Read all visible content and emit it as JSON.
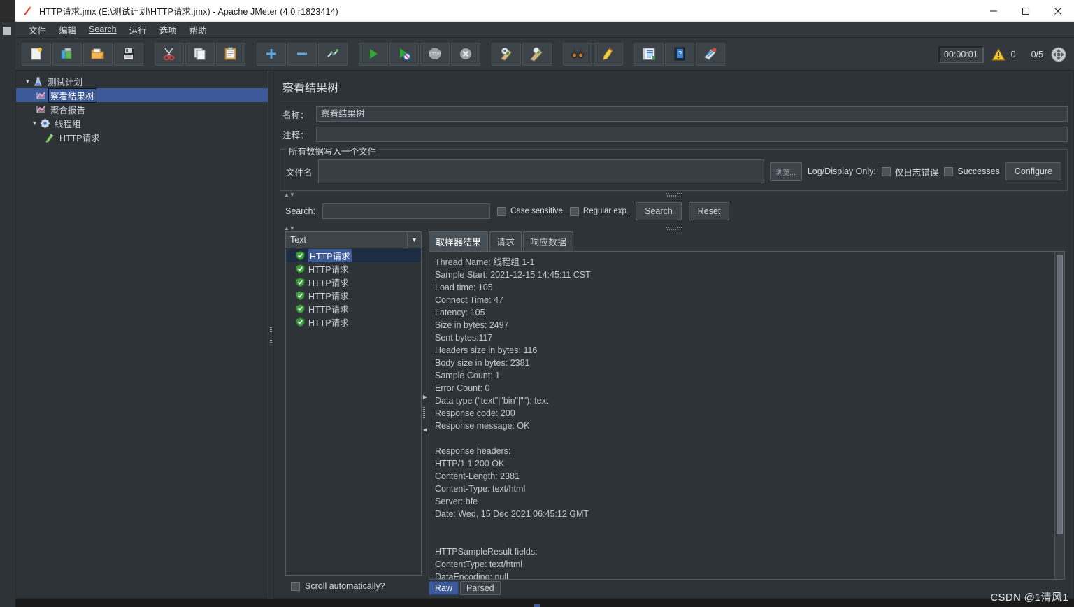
{
  "window": {
    "title": "HTTP请求.jmx (E:\\测试计划\\HTTP请求.jmx) - Apache JMeter (4.0 r1823414)",
    "app_icon": "jmeter-feather-icon",
    "minimize_label": "—",
    "maximize_label": "☐",
    "close_label": "✕"
  },
  "menubar": {
    "items": [
      {
        "label": "文件",
        "name": "menu-file"
      },
      {
        "label": "编辑",
        "name": "menu-edit"
      },
      {
        "label": "Search",
        "name": "menu-search",
        "mnemonic": "S"
      },
      {
        "label": "运行",
        "name": "menu-run"
      },
      {
        "label": "选项",
        "name": "menu-options"
      },
      {
        "label": "帮助",
        "name": "menu-help"
      }
    ]
  },
  "toolbar": {
    "buttons": [
      {
        "name": "new-icon",
        "title": "新建"
      },
      {
        "name": "templates-icon",
        "title": "模板"
      },
      {
        "name": "open-icon",
        "title": "打开"
      },
      {
        "name": "save-icon",
        "title": "保存"
      },
      {
        "name": "cut-icon",
        "title": "剪切"
      },
      {
        "name": "copy-icon",
        "title": "复制"
      },
      {
        "name": "paste-icon",
        "title": "粘贴"
      },
      {
        "name": "expand-all-icon",
        "title": "展开"
      },
      {
        "name": "collapse-all-icon",
        "title": "折叠"
      },
      {
        "name": "toggle-icon",
        "title": "启用/禁用"
      },
      {
        "name": "start-icon",
        "title": "启动"
      },
      {
        "name": "start-no-timers-icon",
        "title": "无暂停启动"
      },
      {
        "name": "stop-icon",
        "title": "停止"
      },
      {
        "name": "shutdown-icon",
        "title": "关闭"
      },
      {
        "name": "clear-icon",
        "title": "清除"
      },
      {
        "name": "clear-all-icon",
        "title": "清除全部"
      },
      {
        "name": "search-binoculars-icon",
        "title": "查找"
      },
      {
        "name": "reset-search-icon",
        "title": "重置查找"
      },
      {
        "name": "function-helper-icon",
        "title": "函数助手"
      },
      {
        "name": "help-icon",
        "title": "帮助"
      },
      {
        "name": "undo-redo-icon",
        "title": "撤销"
      }
    ],
    "timer": "00:00:01",
    "warning_icon": "warning-triangle-icon",
    "warning_count": "0",
    "thread_count": "0/5",
    "gc_icon": "clear-gc-icon"
  },
  "tree": {
    "nodes": [
      {
        "label": "测试计划",
        "icon": "test-plan-icon",
        "depth": 0,
        "toggle": "▼",
        "selected": false,
        "name": "tree-node-test-plan"
      },
      {
        "label": "察看结果树",
        "icon": "view-results-tree-icon",
        "depth": 1,
        "toggle": "",
        "selected": true,
        "name": "tree-node-view-results-tree"
      },
      {
        "label": "聚合报告",
        "icon": "aggregate-report-icon",
        "depth": 1,
        "toggle": "",
        "selected": false,
        "name": "tree-node-aggregate-report"
      },
      {
        "label": "线程组",
        "icon": "thread-group-icon",
        "depth": 0,
        "toggle": "▼",
        "selected": false,
        "name": "tree-node-thread-group"
      },
      {
        "label": "HTTP请求",
        "icon": "http-request-icon",
        "depth": 1,
        "toggle": "",
        "selected": false,
        "name": "tree-node-http-request"
      }
    ]
  },
  "panel": {
    "title": "察看结果树",
    "name_label": "名称：",
    "name_value": "察看结果树",
    "comment_label": "注释：",
    "comment_value": "",
    "filegroup": {
      "legend": "所有数据写入一个文件",
      "filename_label": "文件名",
      "filename_value": "",
      "browse_label": "浏览...",
      "logdisplay_label": "Log/Display Only:",
      "errors_only_label": "仅日志错误",
      "errors_only_checked": false,
      "successes_label": "Successes",
      "successes_checked": false,
      "configure_label": "Configure"
    },
    "search": {
      "label": "Search:",
      "value": "",
      "case_sensitive_label": "Case sensitive",
      "case_sensitive_checked": false,
      "regex_label": "Regular exp.",
      "regex_checked": false,
      "search_button": "Search",
      "reset_button": "Reset"
    }
  },
  "sampler_panel": {
    "render_selector_value": "Text",
    "render_selector_arrow": "▼",
    "results": [
      {
        "label": "HTTP请求",
        "status": "success",
        "selected": true
      },
      {
        "label": "HTTP请求",
        "status": "success",
        "selected": false
      },
      {
        "label": "HTTP请求",
        "status": "success",
        "selected": false
      },
      {
        "label": "HTTP请求",
        "status": "success",
        "selected": false
      },
      {
        "label": "HTTP请求",
        "status": "success",
        "selected": false
      },
      {
        "label": "HTTP请求",
        "status": "success",
        "selected": false
      }
    ],
    "scroll_auto_label": "Scroll automatically?",
    "scroll_auto_checked": false
  },
  "detail": {
    "tabs": [
      {
        "label": "取样器结果",
        "active": true,
        "name": "tab-sampler-result"
      },
      {
        "label": "请求",
        "active": false,
        "name": "tab-request"
      },
      {
        "label": "响应数据",
        "active": false,
        "name": "tab-response-data"
      }
    ],
    "body": "Thread Name: 线程组 1-1\nSample Start: 2021-12-15 14:45:11 CST\nLoad time: 105\nConnect Time: 47\nLatency: 105\nSize in bytes: 2497\nSent bytes:117\nHeaders size in bytes: 116\nBody size in bytes: 2381\nSample Count: 1\nError Count: 0\nData type (\"text\"|\"bin\"|\"\"): text\nResponse code: 200\nResponse message: OK\n\nResponse headers:\nHTTP/1.1 200 OK\nContent-Length: 2381\nContent-Type: text/html\nServer: bfe\nDate: Wed, 15 Dec 2021 06:45:12 GMT\n\n\nHTTPSampleResult fields:\nContentType: text/html\nDataEncoding: null",
    "raw_tabs": [
      {
        "label": "Raw",
        "active": true,
        "name": "tab-raw"
      },
      {
        "label": "Parsed",
        "active": false,
        "name": "tab-parsed"
      }
    ]
  },
  "watermark": "CSDN @1清风1",
  "colors": {
    "window_bg": "#2e3338",
    "toolbar_bg": "#32383d",
    "selection_blue": "#3c5a99",
    "text": "#c9d0d6",
    "border": "#555c62"
  }
}
